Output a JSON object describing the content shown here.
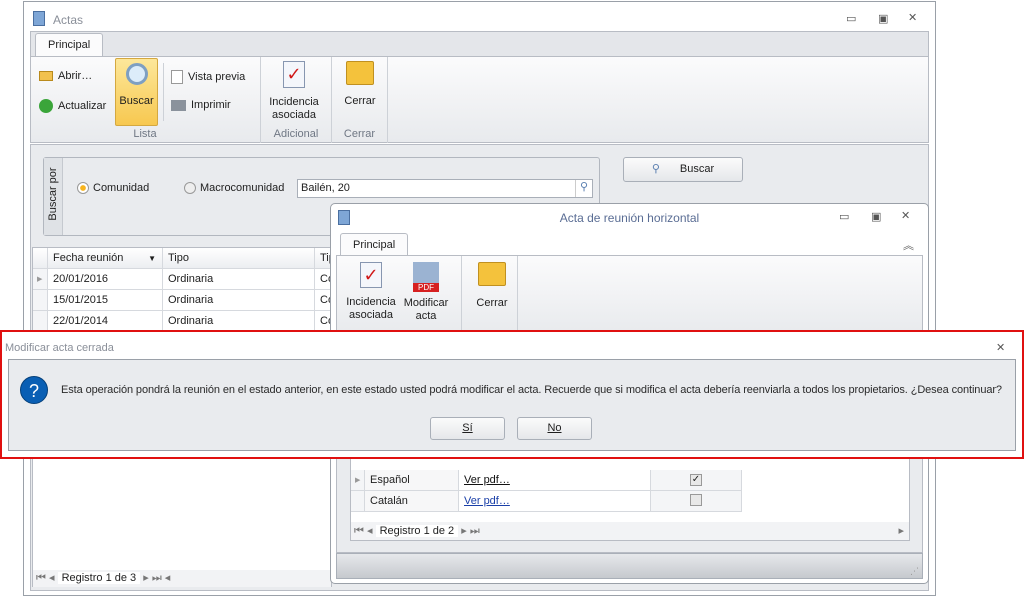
{
  "main_window": {
    "title": "Actas",
    "tab": "Principal",
    "ribbon": {
      "abrir": "Abrir…",
      "actualizar": "Actualizar",
      "buscar": "Buscar",
      "vista_previa": "Vista previa",
      "imprimir": "Imprimir",
      "incidencia": "Incidencia asociada",
      "cerrar": "Cerrar",
      "groups": {
        "lista": "Lista",
        "adicional": "Adicional",
        "cerrar": "Cerrar"
      }
    },
    "search": {
      "group_label": "Buscar por",
      "radio_comunidad": "Comunidad",
      "radio_macro": "Macrocomunidad",
      "selected": "Comunidad",
      "value": "Bailén, 20",
      "button": "Buscar"
    },
    "grid": {
      "columns": [
        "Fecha reunión",
        "Tipo",
        "Tip"
      ],
      "rows": [
        [
          "20/01/2016",
          "Ordinaria",
          "Co"
        ],
        [
          "15/01/2015",
          "Ordinaria",
          "Co"
        ],
        [
          "22/01/2014",
          "Ordinaria",
          "Co"
        ]
      ],
      "nav": "Registro 1 de 3"
    }
  },
  "child_window": {
    "title": "Acta de reunión horizontal",
    "tab": "Principal",
    "ribbon": {
      "incidencia": "Incidencia asociada",
      "modificar": "Modificar acta",
      "cerrar": "Cerrar",
      "pdf_badge": "PDF"
    },
    "grid": {
      "rows": [
        {
          "idioma": "Español",
          "pdf": "Ver pdf…",
          "checked": true
        },
        {
          "idioma": "Catalán",
          "pdf": "Ver pdf…",
          "checked": false
        }
      ],
      "nav": "Registro 1 de 2"
    }
  },
  "dialog": {
    "title": "Modificar acta cerrada",
    "message": "Esta operación pondrá la reunión en el estado anterior, en este estado usted podrá modificar el acta. Recuerde que si modifica el acta debería reenviarla a todos los propietarios. ¿Desea continuar?",
    "yes": "Sí",
    "no": "No",
    "icon": "?"
  }
}
